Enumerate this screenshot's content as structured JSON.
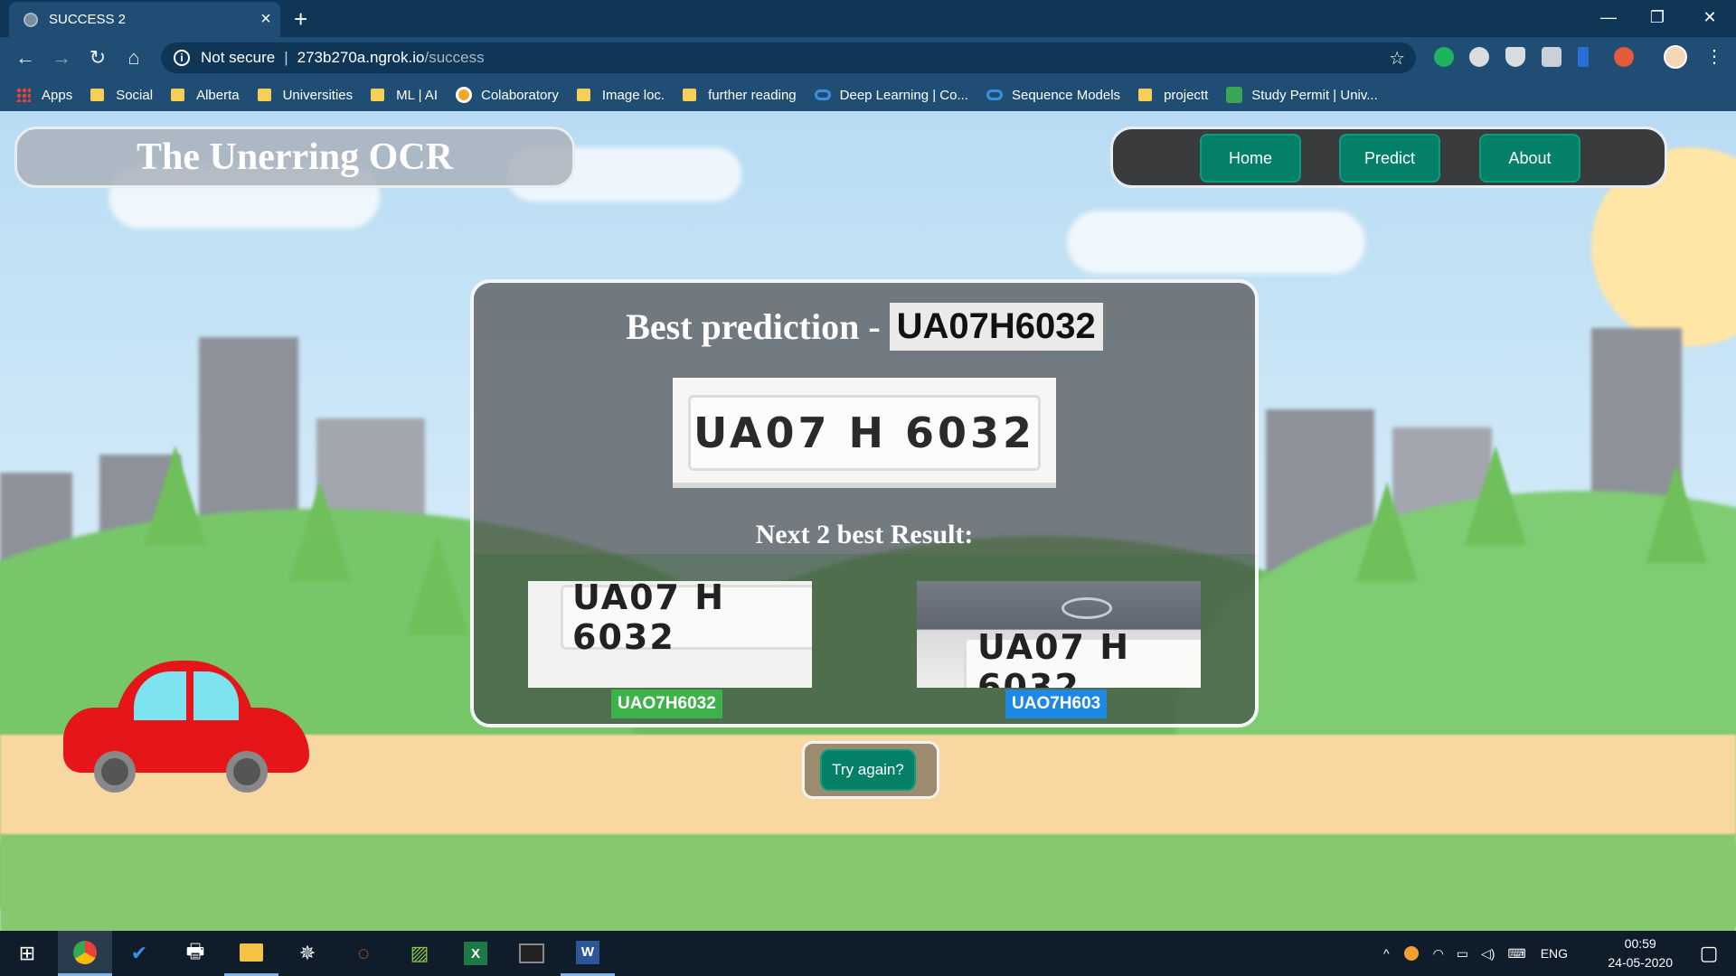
{
  "browser": {
    "tab_title": "SUCCESS 2",
    "new_tab": "+",
    "security_label": "Not secure",
    "url_host": "273b270a.ngrok.io",
    "url_path": "/success"
  },
  "bookmarks": [
    {
      "label": "Apps"
    },
    {
      "label": "Social"
    },
    {
      "label": "Alberta"
    },
    {
      "label": "Universities"
    },
    {
      "label": "ML | AI"
    },
    {
      "label": "Colaboratory"
    },
    {
      "label": "Image loc."
    },
    {
      "label": "further reading"
    },
    {
      "label": "Deep Learning | Co..."
    },
    {
      "label": "Sequence Models"
    },
    {
      "label": "projectt"
    },
    {
      "label": "Study Permit | Univ..."
    }
  ],
  "page": {
    "brand": "The Unerring OCR",
    "nav": {
      "home": "Home",
      "predict": "Predict",
      "about": "About"
    },
    "best_label": "Best prediction -",
    "best_value": "UA07H6032",
    "plate_main_text": "UA07 H 6032",
    "next_title": "Next 2 best Result:",
    "results": [
      {
        "plate_text": "UA07 H 6032",
        "tag": "UAO7H6032",
        "tag_color": "#3db24a"
      },
      {
        "plate_text": "UA07 H 6032",
        "tag": "UAO7H603",
        "tag_color": "#1e88e5"
      }
    ],
    "try_again": "Try again?"
  },
  "taskbar": {
    "lang": "ENG",
    "time": "00:59",
    "date": "24-05-2020"
  },
  "colors": {
    "button_teal": "#058068",
    "chrome_dark": "#0f3557",
    "chrome_toolbar": "#1f4d73"
  }
}
